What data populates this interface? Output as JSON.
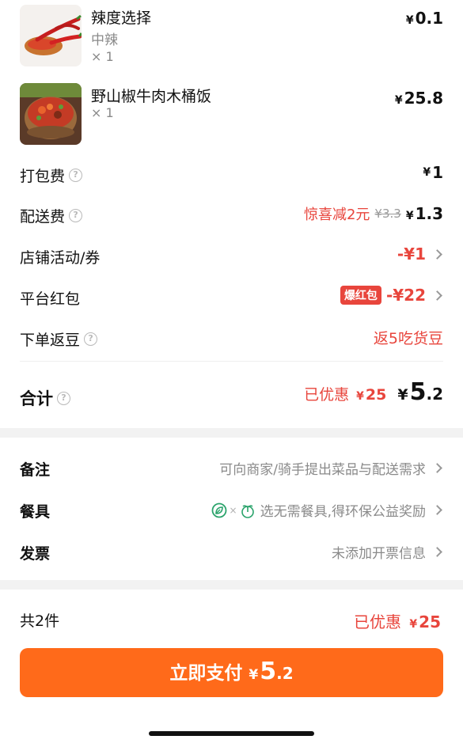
{
  "items": [
    {
      "name": "辣度选择",
      "option": "中辣",
      "qty": "× 1",
      "currency": "¥",
      "price": "0.1",
      "image_icon": "chili-powder-image"
    },
    {
      "name": "野山椒牛肉木桶饭",
      "qty": "× 1",
      "currency": "¥",
      "price": "25.8",
      "image_icon": "rice-bowl-image"
    }
  ],
  "fees": {
    "packing": {
      "label": "打包费",
      "currency": "¥",
      "value": "1"
    },
    "delivery": {
      "label": "配送费",
      "promo": "惊喜减2元",
      "original": "¥3.3",
      "currency": "¥",
      "value": "1.3"
    },
    "store_coupon": {
      "label": "店铺活动/券",
      "value": "-¥1"
    },
    "platform_red_packet": {
      "label": "平台红包",
      "tag": "爆红包",
      "value": "-¥22"
    },
    "order_bonus": {
      "label": "下单返豆",
      "value": "返5吃货豆"
    }
  },
  "total": {
    "label": "合计",
    "discount_text": "已优惠",
    "discount_currency": "¥",
    "discount_value": "25",
    "currency": "¥",
    "int_part": "5",
    "dec_part": ".2"
  },
  "options": {
    "note": {
      "label": "备注",
      "value": "可向商家/骑手提出菜品与配送需求"
    },
    "utensils": {
      "label": "餐具",
      "value": "选无需餐具,得环保公益奖励"
    },
    "invoice": {
      "label": "发票",
      "value": "未添加开票信息"
    }
  },
  "footer": {
    "count": "共2件",
    "discount_text": "已优惠",
    "discount_currency": "¥",
    "discount_value": "25",
    "pay_label": "立即支付",
    "pay_currency": "¥",
    "pay_int": "5",
    "pay_dec": ".2"
  },
  "colors": {
    "accent": "#ff6a1a",
    "red": "#e8453c",
    "muted": "#8a8a8a",
    "eco_green": "#2aa36b"
  }
}
